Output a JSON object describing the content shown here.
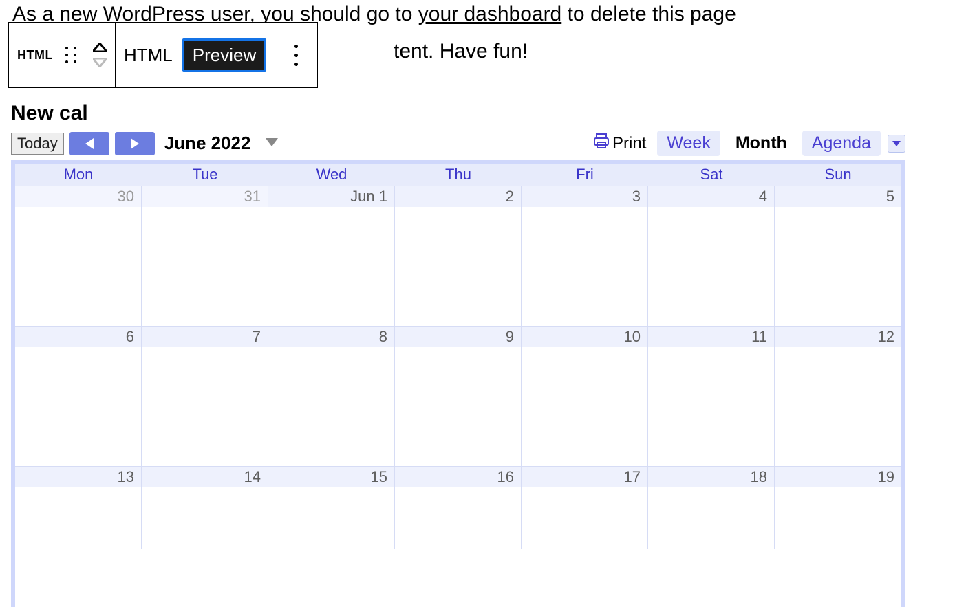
{
  "paragraph": {
    "line1_pre": "As a new WordPress user, you should go to ",
    "dashboard_link": "your dashboard",
    "line1_post": " to delete this page",
    "line2_tail": "tent. Have fun!"
  },
  "toolbar": {
    "block_type_chip": "HTML",
    "mode_html": "HTML",
    "mode_preview": "Preview"
  },
  "calendar": {
    "title": "New cal",
    "today": "Today",
    "month_year": "June 2022",
    "print": "Print",
    "views": {
      "week": "Week",
      "month": "Month",
      "agenda": "Agenda"
    },
    "day_headers": [
      "Mon",
      "Tue",
      "Wed",
      "Thu",
      "Fri",
      "Sat",
      "Sun"
    ],
    "rows": [
      [
        {
          "label": "30",
          "other": true
        },
        {
          "label": "31",
          "other": true
        },
        {
          "label": "Jun 1",
          "other": false
        },
        {
          "label": "2",
          "other": false
        },
        {
          "label": "3",
          "other": false
        },
        {
          "label": "4",
          "other": false
        },
        {
          "label": "5",
          "other": false
        }
      ],
      [
        {
          "label": "6",
          "other": false
        },
        {
          "label": "7",
          "other": false
        },
        {
          "label": "8",
          "other": false
        },
        {
          "label": "9",
          "other": false
        },
        {
          "label": "10",
          "other": false
        },
        {
          "label": "11",
          "other": false
        },
        {
          "label": "12",
          "other": false
        }
      ],
      [
        {
          "label": "13",
          "other": false
        },
        {
          "label": "14",
          "other": false
        },
        {
          "label": "15",
          "other": false
        },
        {
          "label": "16",
          "other": false
        },
        {
          "label": "17",
          "other": false
        },
        {
          "label": "18",
          "other": false
        },
        {
          "label": "19",
          "other": false
        }
      ]
    ]
  }
}
